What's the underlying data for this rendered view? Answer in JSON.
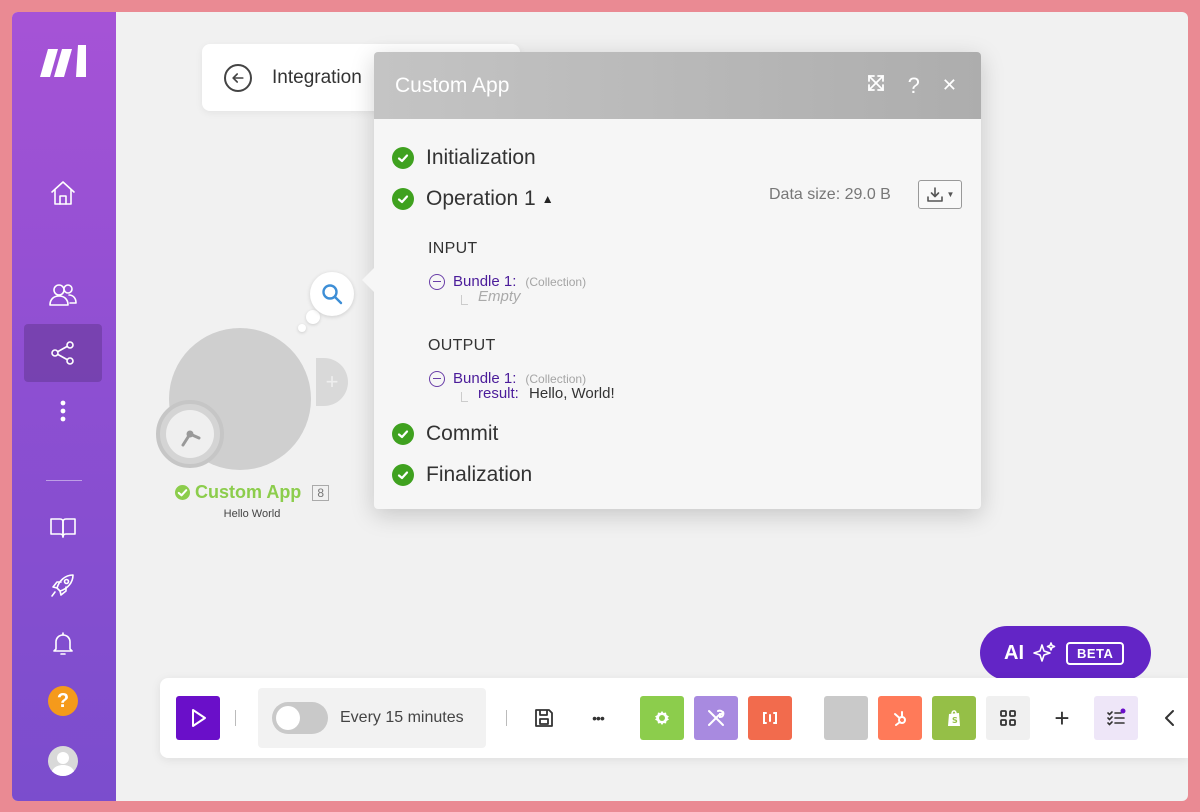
{
  "header": {
    "title": "Integration"
  },
  "sidebar": {
    "items": [
      {
        "icon": "logo-icon"
      },
      {
        "icon": "home-icon"
      },
      {
        "icon": "team-icon"
      },
      {
        "icon": "scenarios-icon"
      },
      {
        "icon": "more-icon"
      },
      {
        "icon": "book-icon"
      },
      {
        "icon": "rocket-icon"
      },
      {
        "icon": "bell-icon"
      },
      {
        "icon": "help-icon",
        "label": "?"
      },
      {
        "icon": "avatar"
      }
    ]
  },
  "node": {
    "name": "Custom App",
    "count": "8",
    "subtitle": "Hello World",
    "plus": "+"
  },
  "panel": {
    "title": "Custom App",
    "help": "?",
    "close": "✕",
    "phases": {
      "initialization": "Initialization",
      "operation": "Operation 1",
      "commit": "Commit",
      "finalization": "Finalization"
    },
    "data_size": "Data size: 29.0 B",
    "input": {
      "title": "INPUT",
      "bundle_label": "Bundle 1:",
      "bundle_type": "(Collection)",
      "empty": "Empty"
    },
    "output": {
      "title": "OUTPUT",
      "bundle_label": "Bundle 1:",
      "bundle_type": "(Collection)",
      "result_key": "result:",
      "result_value": "Hello, World!"
    }
  },
  "ai": {
    "label": "AI",
    "badge": "BETA"
  },
  "toolbar": {
    "schedule_label": "Every 15 minutes",
    "more": "•••",
    "add": "+"
  },
  "colors": {
    "brand_purple": "#6a0fc9",
    "ai_purple": "#6325c6",
    "success_green": "#3fa11f",
    "module_green": "#8ccd4c",
    "tools_purple": "#a88ae0",
    "flow_orange": "#f26b4d",
    "hubspot_orange": "#ff7a59",
    "shopify_green": "#95bf47"
  }
}
